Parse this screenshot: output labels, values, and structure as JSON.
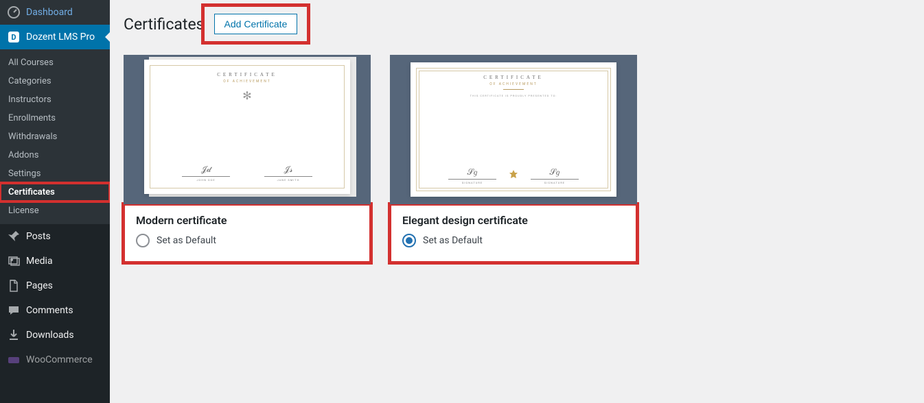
{
  "page": {
    "title": "Certificates",
    "add_button": "Add Certificate"
  },
  "sidebar": {
    "top": [
      {
        "label": "Dashboard",
        "icon": "dashboard"
      },
      {
        "label": "Dozent LMS Pro",
        "icon": "dozent",
        "current": true
      }
    ],
    "submenu": [
      {
        "label": "All Courses"
      },
      {
        "label": "Categories"
      },
      {
        "label": "Instructors"
      },
      {
        "label": "Enrollments"
      },
      {
        "label": "Withdrawals"
      },
      {
        "label": "Addons"
      },
      {
        "label": "Settings"
      },
      {
        "label": "Certificates",
        "current": true
      },
      {
        "label": "License"
      }
    ],
    "bottom": [
      {
        "label": "Posts",
        "icon": "pin"
      },
      {
        "label": "Media",
        "icon": "media"
      },
      {
        "label": "Pages",
        "icon": "page"
      },
      {
        "label": "Comments",
        "icon": "comment"
      },
      {
        "label": "Downloads",
        "icon": "download"
      },
      {
        "label": "WooCommerce",
        "icon": "woo"
      }
    ]
  },
  "certificates": [
    {
      "title": "Modern certificate",
      "set_label": "Set as Default",
      "selected": false,
      "preview": {
        "head": "CERTIFICATE",
        "sub": "OF ACHIEVEMENT",
        "sig1": "JOHN DOE",
        "sig2": "JANE SMITH"
      }
    },
    {
      "title": "Elegant design certificate",
      "set_label": "Set as Default",
      "selected": true,
      "preview": {
        "head": "CERTIFICATE",
        "sub": "OF ACHIEVEMENT",
        "line": "THIS CERTIFICATE IS PROUDLY PRESENTED TO:",
        "sig1": "SIGNATURE",
        "sig2": "SIGNATURE"
      }
    }
  ]
}
